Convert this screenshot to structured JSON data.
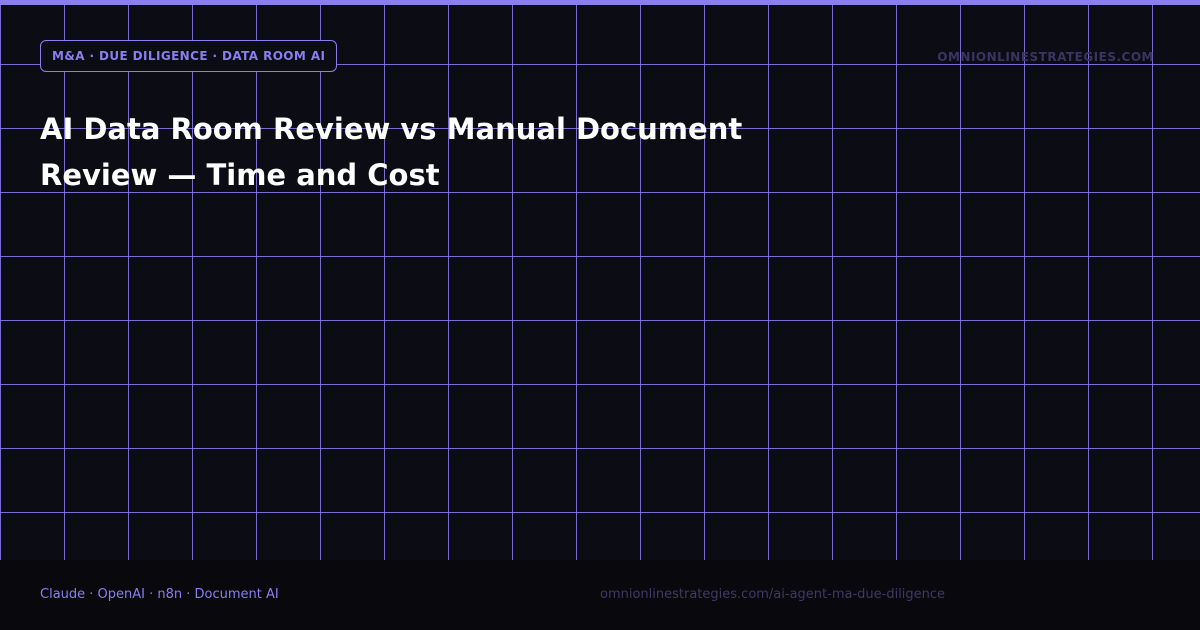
{
  "header": {
    "badge": "M&A · DUE DILIGENCE · DATA ROOM AI",
    "domain": "OMNIONLINESTRATEGIES.COM"
  },
  "title": "AI Data Room Review vs Manual Document Review — Time and Cost",
  "footer": {
    "tech": "Claude · OpenAI · n8n · Document AI",
    "url": "omnionlinestrategies.com/ai-agent-ma-due-diligence"
  },
  "colors": {
    "accent": "#8b7ff0",
    "background": "#0c0c15",
    "footer_background": "#08080d"
  }
}
